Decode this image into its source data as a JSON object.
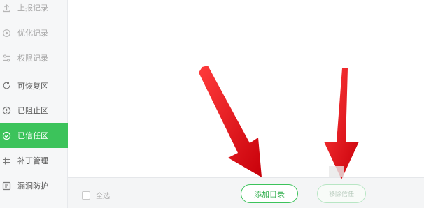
{
  "sidebar": {
    "items": [
      {
        "label": "上报记录",
        "icon": "upload-icon"
      },
      {
        "label": "优化记录",
        "icon": "optimize-icon"
      },
      {
        "label": "权限记录",
        "icon": "permission-icon"
      },
      {
        "label": "可恢复区",
        "icon": "restore-icon"
      },
      {
        "label": "已阻止区",
        "icon": "blocked-icon"
      },
      {
        "label": "已信任区",
        "icon": "trusted-icon"
      },
      {
        "label": "补丁管理",
        "icon": "patch-icon"
      },
      {
        "label": "漏洞防护",
        "icon": "shield-icon"
      }
    ],
    "active_index": 5
  },
  "footer": {
    "select_all_label": "全选",
    "add_directory_label": "添加目录",
    "remove_button_label": "移除信任"
  },
  "colors": {
    "accent_green": "#3cc35b",
    "arrow_red": "#e8141c"
  }
}
